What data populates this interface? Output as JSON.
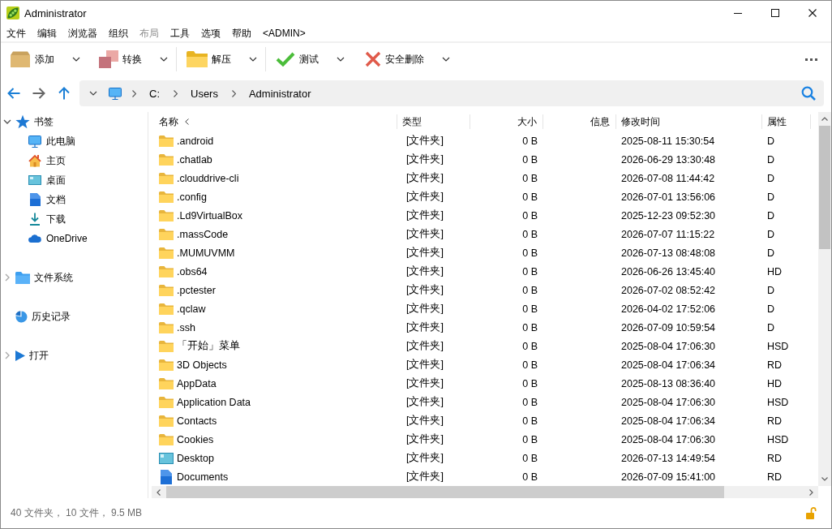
{
  "window": {
    "title": "Administrator"
  },
  "menu": [
    {
      "label": "文件",
      "disabled": false
    },
    {
      "label": "编辑",
      "disabled": false
    },
    {
      "label": "浏览器",
      "disabled": false
    },
    {
      "label": "组织",
      "disabled": false
    },
    {
      "label": "布局",
      "disabled": true
    },
    {
      "label": "工具",
      "disabled": false
    },
    {
      "label": "选项",
      "disabled": false
    },
    {
      "label": "帮助",
      "disabled": false
    },
    {
      "label": "<ADMIN>",
      "disabled": false
    }
  ],
  "toolbar": {
    "groups": [
      {
        "buttons": [
          {
            "label": "添加",
            "kind": "add"
          },
          {
            "label": "转换",
            "kind": "convert"
          }
        ]
      },
      {
        "buttons": [
          {
            "label": "解压",
            "kind": "extract"
          }
        ]
      },
      {
        "buttons": [
          {
            "label": "测试",
            "kind": "test"
          },
          {
            "label": "安全删除",
            "kind": "delete"
          }
        ]
      }
    ]
  },
  "address_bar": {
    "crumbs": [
      "C:",
      "Users",
      "Administrator"
    ]
  },
  "sidebar": {
    "sections": [
      {
        "label": "书签",
        "kind": "bookmarks",
        "expanded": true,
        "items": [
          {
            "label": "此电脑",
            "kind": "computer"
          },
          {
            "label": "主页",
            "kind": "home"
          },
          {
            "label": "桌面",
            "kind": "desktop"
          },
          {
            "label": "文档",
            "kind": "documents"
          },
          {
            "label": "下载",
            "kind": "downloads"
          },
          {
            "label": "OneDrive",
            "kind": "cloud"
          }
        ]
      },
      {
        "label": "文件系统",
        "kind": "filesystem",
        "expanded": false
      },
      {
        "label": "历史记录",
        "kind": "history"
      },
      {
        "label": "打开",
        "kind": "open",
        "expanded": false
      }
    ]
  },
  "table": {
    "columns": [
      {
        "label": "名称",
        "sorted": true
      },
      {
        "label": "类型",
        "sorted": false
      },
      {
        "label": "大小",
        "sorted": false
      },
      {
        "label": "信息",
        "sorted": false
      },
      {
        "label": "修改时间",
        "sorted": false
      },
      {
        "label": "属性",
        "sorted": false
      }
    ],
    "rows": [
      {
        "kind": "folder",
        "name": ".android",
        "type": "[文件夹]",
        "size": "0 B",
        "modified": "2025-08-11 15:30:54",
        "attributes": "D"
      },
      {
        "kind": "folder",
        "name": ".chatlab",
        "type": "[文件夹]",
        "size": "0 B",
        "modified": "2026-06-29 13:30:48",
        "attributes": "D"
      },
      {
        "kind": "folder",
        "name": ".clouddrive-cli",
        "type": "[文件夹]",
        "size": "0 B",
        "modified": "2026-07-08 11:44:42",
        "attributes": "D"
      },
      {
        "kind": "folder",
        "name": ".config",
        "type": "[文件夹]",
        "size": "0 B",
        "modified": "2026-07-01 13:56:06",
        "attributes": "D"
      },
      {
        "kind": "folder",
        "name": ".Ld9VirtualBox",
        "type": "[文件夹]",
        "size": "0 B",
        "modified": "2025-12-23 09:52:30",
        "attributes": "D"
      },
      {
        "kind": "folder",
        "name": ".massCode",
        "type": "[文件夹]",
        "size": "0 B",
        "modified": "2026-07-07 11:15:22",
        "attributes": "D"
      },
      {
        "kind": "folder",
        "name": ".MUMUVMM",
        "type": "[文件夹]",
        "size": "0 B",
        "modified": "2026-07-13 08:48:08",
        "attributes": "D"
      },
      {
        "kind": "folder",
        "name": ".obs64",
        "type": "[文件夹]",
        "size": "0 B",
        "modified": "2026-06-26 13:45:40",
        "attributes": "HD"
      },
      {
        "kind": "folder",
        "name": ".pctester",
        "type": "[文件夹]",
        "size": "0 B",
        "modified": "2026-07-02 08:52:42",
        "attributes": "D"
      },
      {
        "kind": "folder",
        "name": ".qclaw",
        "type": "[文件夹]",
        "size": "0 B",
        "modified": "2026-04-02 17:52:06",
        "attributes": "D"
      },
      {
        "kind": "folder",
        "name": ".ssh",
        "type": "[文件夹]",
        "size": "0 B",
        "modified": "2026-07-09 10:59:54",
        "attributes": "D"
      },
      {
        "kind": "folder",
        "name": "「开始」菜单",
        "type": "[文件夹]",
        "size": "0 B",
        "modified": "2025-08-04 17:06:30",
        "attributes": "HSD"
      },
      {
        "kind": "folder",
        "name": "3D Objects",
        "type": "[文件夹]",
        "size": "0 B",
        "modified": "2025-08-04 17:06:34",
        "attributes": "RD"
      },
      {
        "kind": "folder",
        "name": "AppData",
        "type": "[文件夹]",
        "size": "0 B",
        "modified": "2025-08-13 08:36:40",
        "attributes": "HD"
      },
      {
        "kind": "folder",
        "name": "Application Data",
        "type": "[文件夹]",
        "size": "0 B",
        "modified": "2025-08-04 17:06:30",
        "attributes": "HSD"
      },
      {
        "kind": "folder",
        "name": "Contacts",
        "type": "[文件夹]",
        "size": "0 B",
        "modified": "2025-08-04 17:06:34",
        "attributes": "RD"
      },
      {
        "kind": "folder",
        "name": "Cookies",
        "type": "[文件夹]",
        "size": "0 B",
        "modified": "2025-08-04 17:06:30",
        "attributes": "HSD"
      },
      {
        "kind": "desktop",
        "name": "Desktop",
        "type": "[文件夹]",
        "size": "0 B",
        "modified": "2026-07-13 14:49:54",
        "attributes": "RD"
      },
      {
        "kind": "documents",
        "name": "Documents",
        "type": "[文件夹]",
        "size": "0 B",
        "modified": "2026-07-09 15:41:00",
        "attributes": "RD"
      }
    ]
  },
  "status_bar": {
    "text": "40 文件夹， 10 文件， 9.5 MB"
  }
}
